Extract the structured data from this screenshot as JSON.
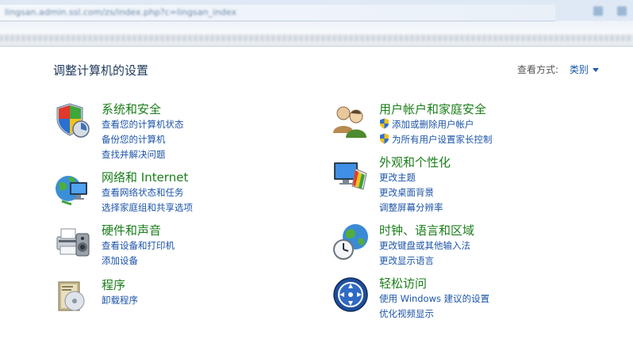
{
  "browser": {
    "address": "lingsan.admin.ssl.com/zs/index.php?c=lingsan_index"
  },
  "page": {
    "title": "调整计算机的设置",
    "view_by_label": "查看方式:",
    "view_by_value": "类别"
  },
  "left_categories": [
    {
      "title": "系统和安全",
      "icon": "shield-icon",
      "links": [
        "查看您的计算机状态",
        "备份您的计算机",
        "查找并解决问题"
      ]
    },
    {
      "title": "网络和 Internet",
      "icon": "network-icon",
      "links": [
        "查看网络状态和任务",
        "选择家庭组和共享选项"
      ]
    },
    {
      "title": "硬件和声音",
      "icon": "printer-icon",
      "links": [
        "查看设备和打印机",
        "添加设备"
      ]
    },
    {
      "title": "程序",
      "icon": "programs-icon",
      "links": [
        "卸载程序"
      ]
    }
  ],
  "right_categories": [
    {
      "title": "用户帐户和家庭安全",
      "icon": "users-icon",
      "links": [
        "添加或删除用户帐户",
        "为所有用户设置家长控制"
      ]
    },
    {
      "title": "外观和个性化",
      "icon": "appearance-icon",
      "links": [
        "更改主题",
        "更改桌面背景",
        "调整屏幕分辨率"
      ]
    },
    {
      "title": "时钟、语言和区域",
      "icon": "clock-globe-icon",
      "links": [
        "更改键盘或其他输入法",
        "更改显示语言"
      ]
    },
    {
      "title": "轻松访问",
      "icon": "ease-of-access-icon",
      "links": [
        "使用 Windows 建议的设置",
        "优化视频显示"
      ]
    }
  ]
}
